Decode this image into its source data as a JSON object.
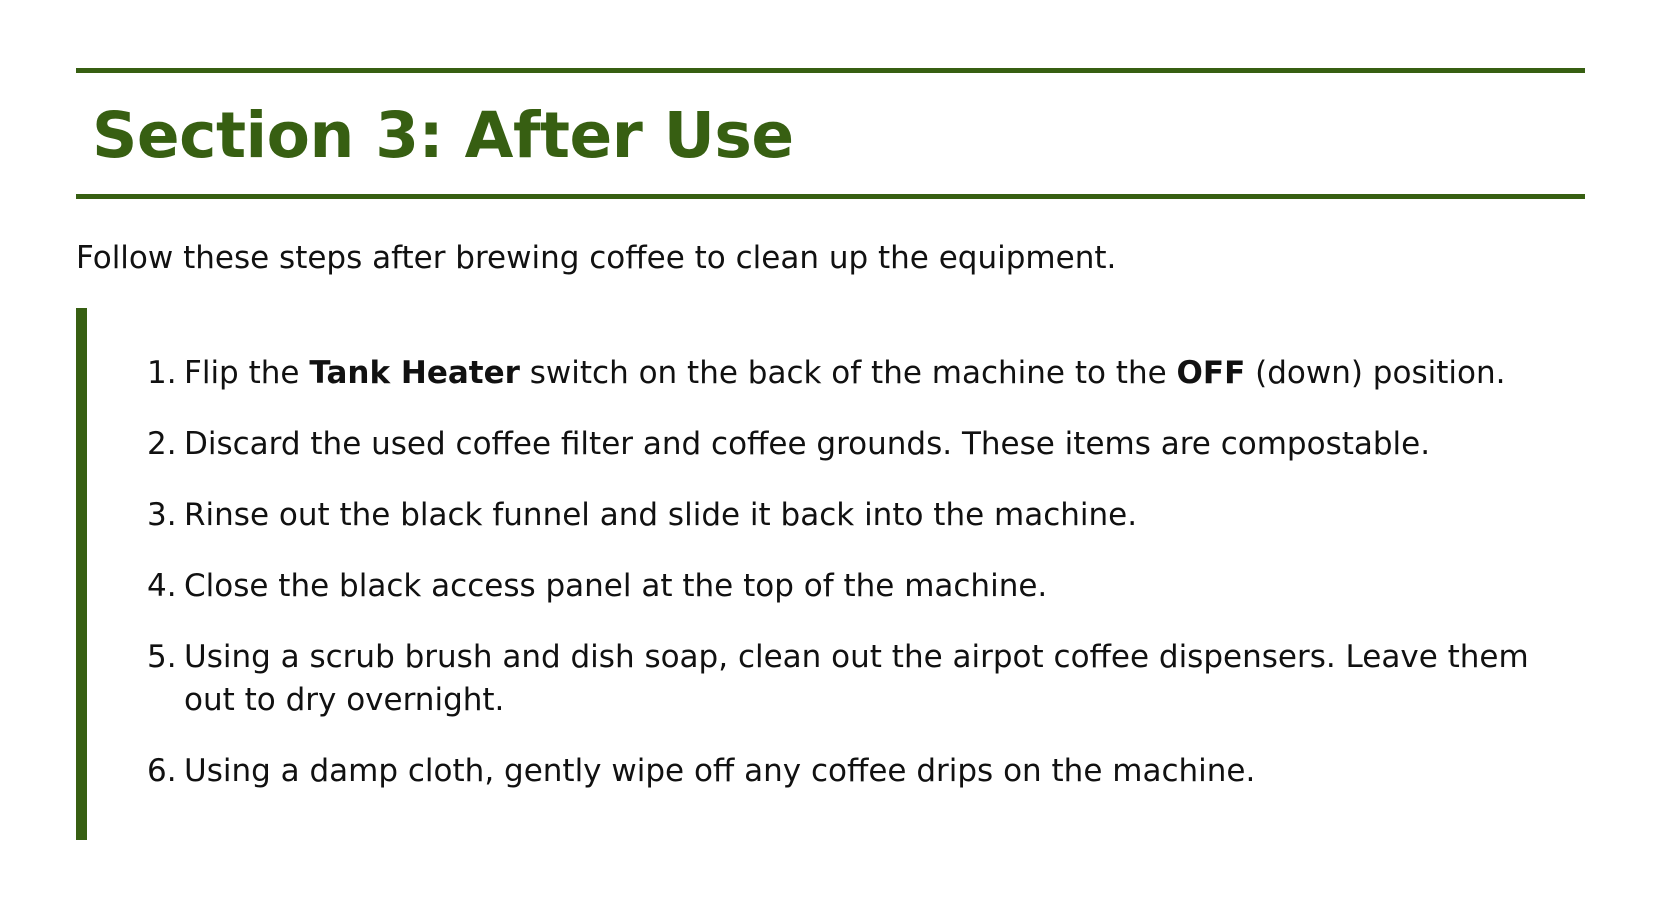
{
  "colors": {
    "accent": "#375f12",
    "text": "#111111",
    "background": "#ffffff"
  },
  "section": {
    "title": "Section 3: After Use",
    "intro": "Follow these steps after brewing coffee to clean up the equipment."
  },
  "steps": [
    {
      "number": "1.",
      "text_a": "Flip the ",
      "bold_a": "Tank Heater",
      "text_b": " switch on the back of the machine to the ",
      "bold_b": "OFF",
      "text_c": " (down) position."
    },
    {
      "number": "2.",
      "text": "Discard the used coffee filter and coffee grounds. These items are compostable."
    },
    {
      "number": "3.",
      "text": "Rinse out the black funnel and slide it back into the machine."
    },
    {
      "number": "4.",
      "text": "Close the black access panel at the top of the machine."
    },
    {
      "number": "5.",
      "text": "Using a scrub brush and dish soap, clean out the airpot coffee dispensers. Leave them out to dry overnight."
    },
    {
      "number": "6.",
      "text": "Using a damp cloth, gently wipe off any coffee drips on the machine."
    }
  ]
}
